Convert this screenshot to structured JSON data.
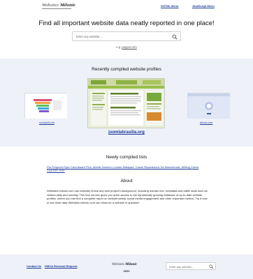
{
  "header": {
    "logo_prefix": "Websites",
    "logo_brand": "Milonic",
    "nav": {
      "dhtml": "DHTML Menu",
      "javascript": "JavaScript Menu"
    }
  },
  "hero": {
    "title": "Find all important website data neatly reported in one place!",
    "search_placeholder": "Enter any website...",
    "example_prefix": "e.g.",
    "example_link": "paypal.com"
  },
  "profiles": {
    "title": "Recently compiled website profiles",
    "items": [
      {
        "caption": "contact3.net"
      },
      {
        "caption": "joomlabrasilia.org"
      },
      {
        "caption": "elhok.com"
      }
    ]
  },
  "lists": {
    "title": "Newly compiled lists",
    "links_text": "Pia Frequent Flyer Card Award Plus, Mobile Number Locator Malaysia, Casse Reparaciòns De Banovtenda, Writing Check CASTEP, PSP"
  },
  "about": {
    "title": "About",
    "text": "Websites.milonic.com can instantly reveal any web project's background, including domain info, metadata and traffic stats such as visitors daily and monthly. This free service gives you quick access to the dynamically growing database of up-to-date website profiles, where you can find a complete report on website safety, social media engagement and other important metrics. Try it now to see what data Websites.milonic.com can show for a website in question!"
  },
  "footer": {
    "contact": "Contact Us",
    "dmca": "DMCA Removal Request",
    "logo_prefix": "Websites",
    "logo_brand": "Milonic",
    "year": "2022",
    "search_placeholder": "Enter any website..."
  },
  "colors": {
    "link": "#1a3a9a",
    "band": "#eef1f8"
  }
}
